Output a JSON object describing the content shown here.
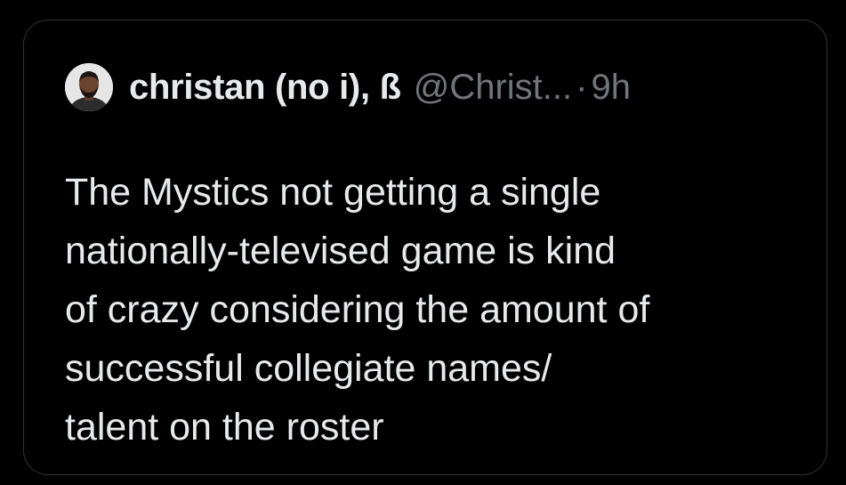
{
  "quoted_tweet": {
    "author": {
      "display_name": "christan (no i), ß",
      "handle": "@Christ...",
      "avatar_icon": "user-avatar"
    },
    "separator": "·",
    "timestamp": "9h",
    "text": "The Mystics not getting a single\nnationally-televised game is kind\nof crazy considering the amount of\nsuccessful collegiate names/\ntalent on the roster"
  },
  "colors": {
    "background": "#000000",
    "border": "#2f3336",
    "primary_text": "#e7e9ea",
    "secondary_text": "#71767b"
  }
}
